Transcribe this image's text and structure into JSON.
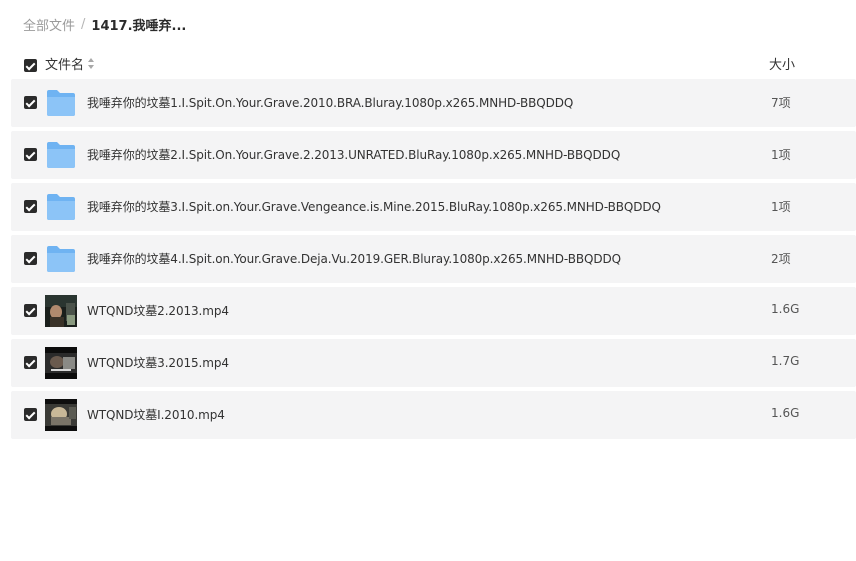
{
  "breadcrumb": {
    "root": "全部文件",
    "separator": "/",
    "current": "1417.我唾弃..."
  },
  "header": {
    "name_label": "文件名",
    "size_label": "大小",
    "sort_icon": "sort-icon"
  },
  "colors": {
    "row_background": "#f4f4f5",
    "checkbox": "#2b2b2b",
    "folder": "#5aa7f0"
  },
  "files": [
    {
      "type": "folder",
      "name": "我唾弃你的坟墓1.I.Spit.On.Your.Grave.2010.BRA.Bluray.1080p.x265.MNHD-BBQDDQ",
      "size": "7项"
    },
    {
      "type": "folder",
      "name": "我唾弃你的坟墓2.I.Spit.On.Your.Grave.2.2013.UNRATED.BluRay.1080p.x265.MNHD-BBQDDQ",
      "size": "1项"
    },
    {
      "type": "folder",
      "name": "我唾弃你的坟墓3.I.Spit.on.Your.Grave.Vengeance.is.Mine.2015.BluRay.1080p.x265.MNHD-BBQDDQ",
      "size": "1项"
    },
    {
      "type": "folder",
      "name": "我唾弃你的坟墓4.I.Spit.on.Your.Grave.Deja.Vu.2019.GER.Bluray.1080p.x265.MNHD-BBQDDQ",
      "size": "2项"
    },
    {
      "type": "video",
      "name": "WTQND坟墓2.2013.mp4",
      "size": "1.6G"
    },
    {
      "type": "video",
      "name": "WTQND坟墓3.2015.mp4",
      "size": "1.7G"
    },
    {
      "type": "video",
      "name": "WTQND坟墓I.2010.mp4",
      "size": "1.6G"
    }
  ]
}
